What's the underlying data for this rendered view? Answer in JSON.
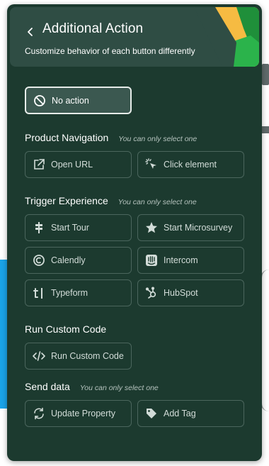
{
  "header": {
    "title": "Additional Action",
    "subtitle": "Customize behavior of each button differently"
  },
  "no_action": {
    "label": "No action"
  },
  "sections": {
    "product_navigation": {
      "title": "Product Navigation",
      "hint": "You can only select one"
    },
    "trigger_experience": {
      "title": "Trigger Experience",
      "hint": "You can only select one"
    },
    "run_custom_code": {
      "title": "Run Custom Code"
    },
    "send_data": {
      "title": "Send data",
      "hint": "You can only select one"
    }
  },
  "buttons": {
    "open_url": "Open URL",
    "click_element": "Click element",
    "start_tour": "Start Tour",
    "start_microsurvey": "Start Microsurvey",
    "calendly": "Calendly",
    "intercom": "Intercom",
    "typeform": "Typeform",
    "hubspot": "HubSpot",
    "run_custom_code": "Run Custom Code",
    "update_property": "Update Property",
    "add_tag": "Add Tag"
  },
  "colors": {
    "panel_bg": "#1c3a2f",
    "header_bg": "#2f4d44",
    "accent_yellow": "#f6bb42",
    "accent_green": "#2bb34b",
    "accent_dark_green": "#1f8f3a"
  }
}
